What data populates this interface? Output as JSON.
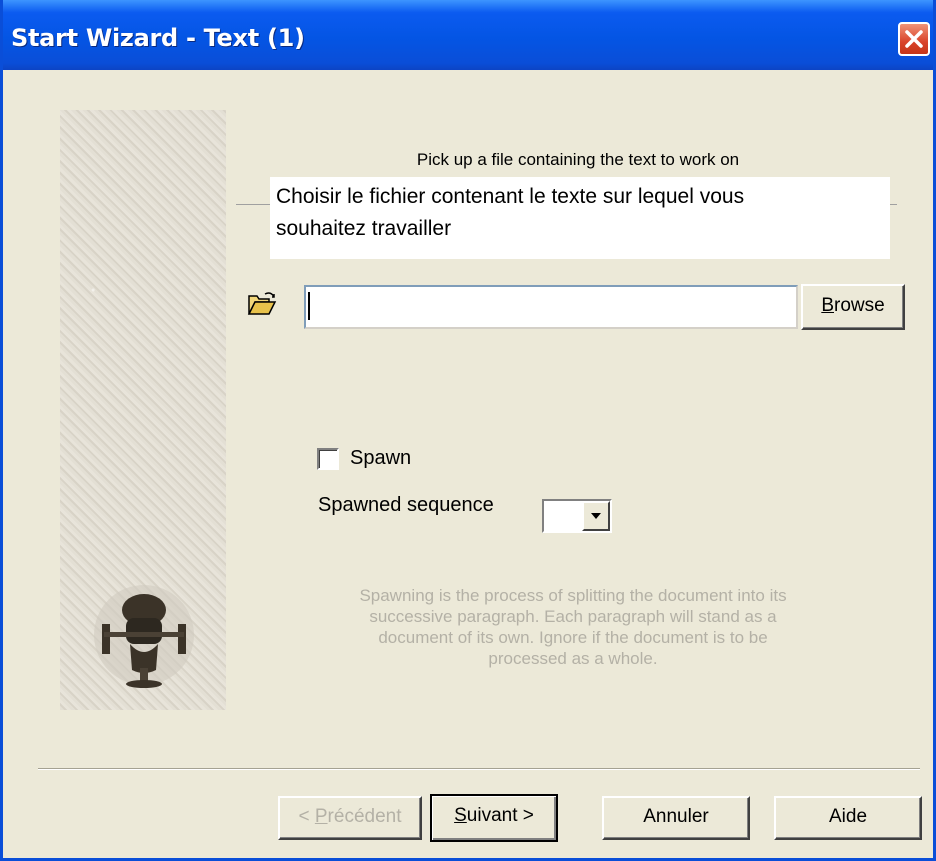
{
  "window": {
    "title": "Start Wizard - Text (1)"
  },
  "labels": {
    "instruction_en": "Pick up a file containing the text to work on",
    "instruction_fr_line1": "Choisir le fichier contenant le texte sur lequel vous",
    "instruction_fr_line2": "souhaitez travailler"
  },
  "file": {
    "path_value": "",
    "browse_mnemonic": "B",
    "browse_rest": "rowse"
  },
  "spawn": {
    "checkbox_label": "Spawn",
    "checked": false,
    "sequence_label": "Spawned sequence",
    "sequence_value": "",
    "help_lines": [
      "Spawning is the process of splitting the document into its",
      "successive paragraph. Each paragraph will stand as a",
      "document of its own. Ignore if the document is to be",
      "processed as a whole."
    ]
  },
  "footer": {
    "prev_prefix": "< ",
    "prev_mnemonic": "P",
    "prev_rest": "récédent",
    "next_mnemonic": "S",
    "next_rest": "uivant >",
    "cancel_label": "Annuler",
    "help_label": "Aide"
  },
  "colors": {
    "titlebar": "#0a4ed8",
    "background": "#ece9d8",
    "close": "#d9432a",
    "disabled_text": "#b4b1a6"
  },
  "icons": [
    "close-icon",
    "folder-open-icon",
    "dropdown-arrow-icon",
    "portrait-image"
  ]
}
